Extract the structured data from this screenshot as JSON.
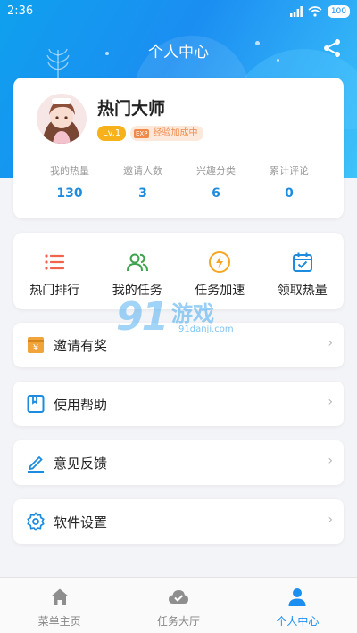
{
  "status_bar": {
    "time": "2:36",
    "battery": "100"
  },
  "header": {
    "title": "个人中心"
  },
  "profile": {
    "name": "热门大师",
    "level": "Lv.1",
    "exp_tag": "EXP",
    "exp_status": "经验加成中",
    "stats": [
      {
        "label": "我的热量",
        "value": "130"
      },
      {
        "label": "邀请人数",
        "value": "3"
      },
      {
        "label": "兴趣分类",
        "value": "6"
      },
      {
        "label": "累计评论",
        "value": "0"
      }
    ]
  },
  "task_shortcuts": [
    {
      "label": "热门排行",
      "icon": "list-icon"
    },
    {
      "label": "我的任务",
      "icon": "users-icon"
    },
    {
      "label": "任务加速",
      "icon": "lightning-icon"
    },
    {
      "label": "领取热量",
      "icon": "calendar-check-icon"
    }
  ],
  "menu": [
    {
      "label": "邀请有奖",
      "icon": "gift-icon"
    },
    {
      "label": "使用帮助",
      "icon": "book-icon"
    },
    {
      "label": "意见反馈",
      "icon": "edit-icon"
    },
    {
      "label": "软件设置",
      "icon": "gear-icon"
    }
  ],
  "watermark": {
    "brand": "91",
    "name": "游戏",
    "url": "91danji.com"
  },
  "tabs": [
    {
      "label": "菜单主页",
      "icon": "home-icon",
      "active": false
    },
    {
      "label": "任务大厅",
      "icon": "cloud-check-icon",
      "active": false
    },
    {
      "label": "个人中心",
      "icon": "user-icon",
      "active": true
    }
  ],
  "colors": {
    "accent": "#1b8ef2",
    "stat_value": "#1e8cde",
    "level_badge": "#f7b21b",
    "exp_badge": "#f08a4b",
    "icon_red": "#f0644b",
    "icon_green": "#3fa34d",
    "icon_orange": "#f5a623",
    "icon_blue": "#1e8cde",
    "gift_orange": "#f0a43a"
  }
}
